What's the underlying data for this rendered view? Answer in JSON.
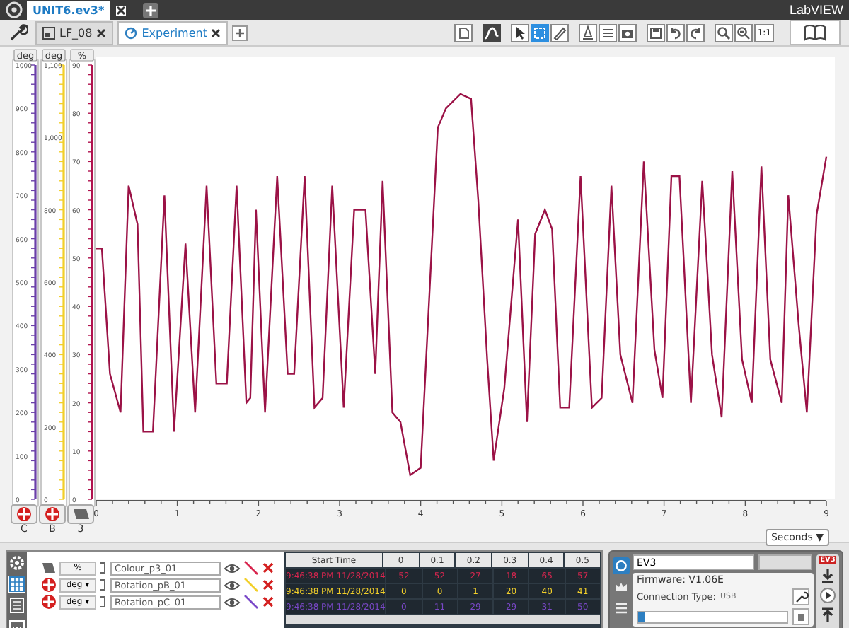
{
  "project_tabs": [
    {
      "label": "UNIT6.ev3*",
      "selected": true
    }
  ],
  "brand": "LabVIEW",
  "program_tabs": [
    {
      "label": "LF_08",
      "kind": "program",
      "selected": false
    },
    {
      "label": "Experiment",
      "kind": "experiment",
      "selected": true
    }
  ],
  "toolbar": {
    "zoom_reset": "1:1"
  },
  "axes": [
    {
      "unit": "deg",
      "color": "#6a3fa8",
      "ticks": [
        "1000",
        "900",
        "800",
        "700",
        "600",
        "500",
        "400",
        "300",
        "200",
        "100",
        "0"
      ]
    },
    {
      "unit": "deg",
      "color": "#f2cf2a",
      "ticks": [
        "1,100",
        "1,000",
        "800",
        "600",
        "400",
        "200",
        "0"
      ]
    },
    {
      "unit": "%",
      "color": "#b0124e"
    }
  ],
  "ports": [
    {
      "label": "C",
      "kind": "motor"
    },
    {
      "label": "B",
      "kind": "motor"
    },
    {
      "label": "3",
      "kind": "sensor"
    }
  ],
  "chart_data": {
    "type": "line",
    "xlim": [
      0,
      9
    ],
    "ylim": [
      0,
      90
    ],
    "xticks": [
      0,
      1,
      2,
      3,
      4,
      5,
      6,
      7,
      8,
      9
    ],
    "yticks": [
      0,
      10,
      20,
      30,
      40,
      50,
      60,
      70,
      80,
      90
    ],
    "x": [
      0,
      0.07,
      0.17,
      0.3,
      0.4,
      0.51,
      0.58,
      0.7,
      0.84,
      0.96,
      1.1,
      1.22,
      1.36,
      1.48,
      1.61,
      1.73,
      1.85,
      1.9,
      1.97,
      2.08,
      2.23,
      2.36,
      2.44,
      2.57,
      2.69,
      2.79,
      2.91,
      3.05,
      3.18,
      3.32,
      3.44,
      3.53,
      3.65,
      3.75,
      3.87,
      4.0,
      4.21,
      4.31,
      4.49,
      4.62,
      4.71,
      4.82,
      4.9,
      5.03,
      5.2,
      5.31,
      5.41,
      5.53,
      5.62,
      5.72,
      5.83,
      5.97,
      6.11,
      6.23,
      6.35,
      6.46,
      6.61,
      6.75,
      6.88,
      6.98,
      7.09,
      7.19,
      7.33,
      7.47,
      7.59,
      7.71,
      7.84,
      7.96,
      8.08,
      8.2,
      8.31,
      8.45,
      8.53,
      8.66,
      8.76,
      8.88,
      9.0
    ],
    "series": [
      {
        "color": "#9b1246",
        "values": [
          52,
          52,
          26,
          18,
          65,
          57,
          14,
          14,
          63,
          14,
          53,
          18,
          65,
          24,
          24,
          65,
          20,
          21,
          60,
          18,
          67,
          26,
          26,
          67,
          19,
          21,
          65,
          19,
          60,
          60,
          26,
          66,
          18,
          16,
          5,
          6.5,
          77,
          81,
          84,
          83,
          62,
          29,
          8,
          23,
          58,
          16,
          55,
          60,
          56,
          19,
          19,
          67,
          19,
          21,
          65,
          30,
          20,
          70,
          31,
          21,
          67,
          67,
          20,
          66,
          30,
          17,
          68,
          29,
          20,
          69,
          29,
          20,
          63,
          36,
          18,
          59,
          71
        ]
      }
    ]
  },
  "x_unit": "Seconds ▼",
  "datasets": [
    {
      "kind": "sensor",
      "unit": "%",
      "name": "Colour_p3_01",
      "color": "#d8264f",
      "start_time": "9:46:38 PM 11/28/2014",
      "values": [
        "52",
        "52",
        "27",
        "18",
        "65",
        "57"
      ]
    },
    {
      "kind": "motor",
      "unit": "deg ▾",
      "name": "Rotation_pB_01",
      "color": "#f2cf2a",
      "start_time": "9:46:38 PM 11/28/2014",
      "values": [
        "0",
        "0",
        "1",
        "20",
        "40",
        "41"
      ]
    },
    {
      "kind": "motor",
      "unit": "deg ▾",
      "name": "Rotation_pC_01",
      "color": "#7a48c8",
      "start_time": "9:46:38 PM 11/28/2014",
      "values": [
        "0",
        "11",
        "29",
        "29",
        "31",
        "50"
      ]
    }
  ],
  "table_columns": [
    "Start Time",
    "0",
    "0.1",
    "0.2",
    "0.3",
    "0.4",
    "0.5"
  ],
  "brick": {
    "name": "EV3",
    "firmware": "Firmware: V1.06E",
    "connection_label": "Connection Type:",
    "connection": "USB",
    "badge": "EV3",
    "memory": {
      "level": 0.05
    }
  }
}
